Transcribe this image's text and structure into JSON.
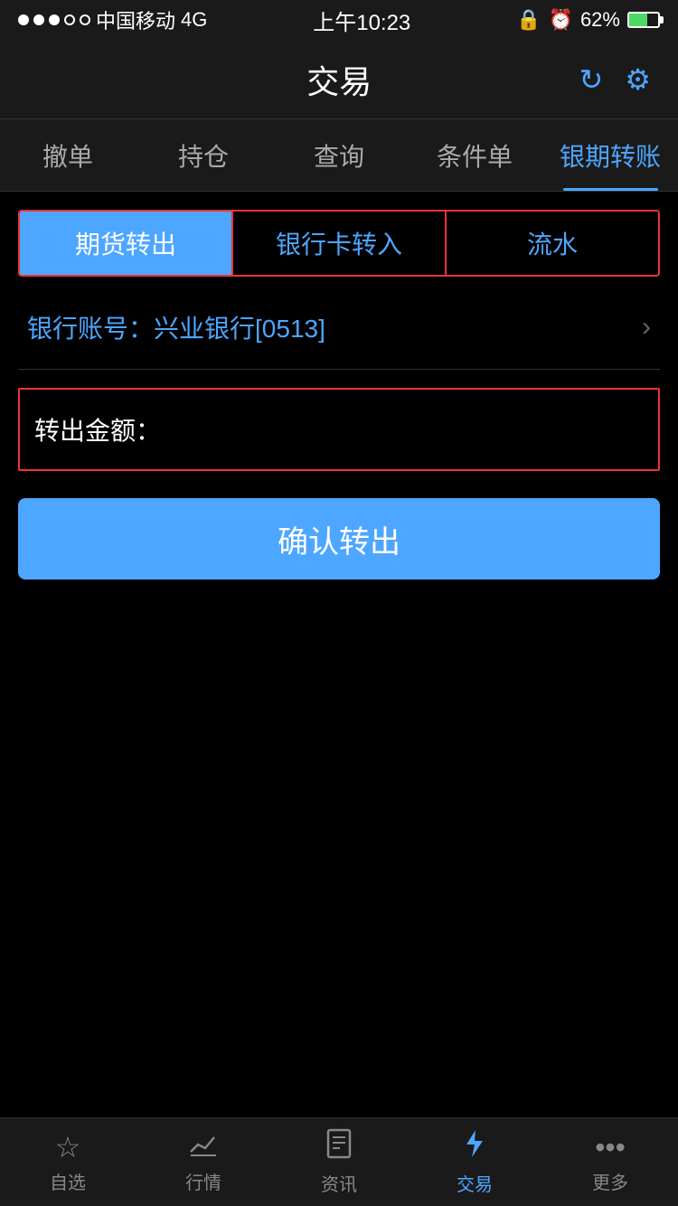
{
  "statusBar": {
    "carrier": "中国移动",
    "network": "4G",
    "time": "上午10:23",
    "battery": "62%"
  },
  "navBar": {
    "title": "交易",
    "refreshIcon": "↻",
    "settingsIcon": "⚙"
  },
  "mainTabs": [
    {
      "id": "cancel",
      "label": "撤单",
      "active": false
    },
    {
      "id": "position",
      "label": "持仓",
      "active": false
    },
    {
      "id": "query",
      "label": "查询",
      "active": false
    },
    {
      "id": "conditional",
      "label": "条件单",
      "active": false
    },
    {
      "id": "transfer",
      "label": "银期转账",
      "active": true
    }
  ],
  "subTabs": [
    {
      "id": "futures-out",
      "label": "期货转出",
      "active": true
    },
    {
      "id": "bank-in",
      "label": "银行卡转入",
      "active": false
    },
    {
      "id": "history",
      "label": "流水",
      "active": false
    }
  ],
  "bankAccount": {
    "label": "银行账号：兴业银行",
    "accountSuffix": "[0513]"
  },
  "amountField": {
    "label": "转出金额：",
    "placeholder": ""
  },
  "confirmButton": {
    "label": "确认转出"
  },
  "bottomTabs": [
    {
      "id": "watchlist",
      "label": "自选",
      "active": false,
      "icon": "star"
    },
    {
      "id": "market",
      "label": "行情",
      "active": false,
      "icon": "chart"
    },
    {
      "id": "news",
      "label": "资讯",
      "active": false,
      "icon": "doc"
    },
    {
      "id": "trade",
      "label": "交易",
      "active": true,
      "icon": "lightning"
    },
    {
      "id": "more",
      "label": "更多",
      "active": false,
      "icon": "dots"
    }
  ]
}
